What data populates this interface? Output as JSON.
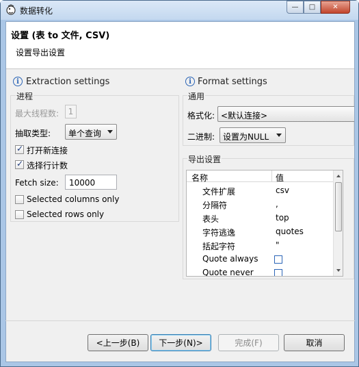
{
  "window": {
    "title": "数据转化",
    "controls": {
      "minimize": "—",
      "maximize": "□",
      "close": "✕"
    }
  },
  "header": {
    "title": "设置 (表 to 文件, CSV)",
    "subtitle": "设置导出设置"
  },
  "extraction": {
    "section_title": "Extraction settings",
    "group_label": "进程",
    "max_threads_label": "最大线程数:",
    "max_threads_value": "1",
    "fetch_type_label": "抽取类型:",
    "fetch_type_value": "单个查询",
    "open_new_connection_label": "打开新连接",
    "open_new_connection_checked": true,
    "select_row_count_label": "选择行计数",
    "select_row_count_checked": true,
    "fetch_size_label": "Fetch size:",
    "fetch_size_value": "10000",
    "selected_columns_label": "Selected columns only",
    "selected_columns_checked": false,
    "selected_rows_label": "Selected rows only",
    "selected_rows_checked": false
  },
  "format": {
    "section_title": "Format settings",
    "group_label": "通用",
    "formatter_label": "格式化:",
    "formatter_value": "<默认连接>",
    "binary_label": "二进制:",
    "binary_value": "设置为NULL",
    "export_group_label": "导出设置",
    "table": {
      "columns": [
        "名称",
        "值"
      ],
      "rows": [
        {
          "name": "文件扩展",
          "value": "csv"
        },
        {
          "name": "分隔符",
          "value": ","
        },
        {
          "name": "表头",
          "value": "top"
        },
        {
          "name": "字符逃逸",
          "value": "quotes"
        },
        {
          "name": "括起字符",
          "value": "\""
        },
        {
          "name": "Quote always",
          "value": ""
        },
        {
          "name": "Quote never",
          "value": ""
        }
      ]
    }
  },
  "buttons": {
    "back": "<上一步(B)",
    "next": "下一步(N)>",
    "finish": "完成(F)",
    "cancel": "取消"
  },
  "colors": {
    "window_frame": "#aac6e6",
    "dialog_bg": "#f0f0f0",
    "info_blue": "#2a64b6"
  }
}
